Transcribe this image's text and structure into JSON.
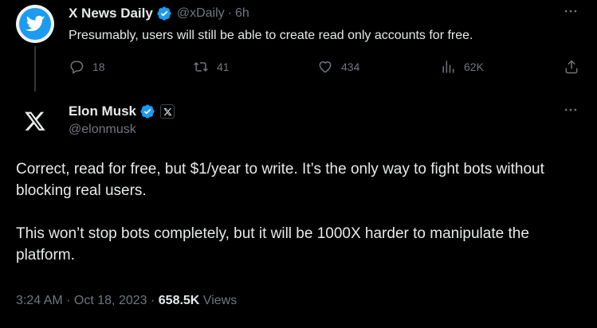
{
  "parent_tweet": {
    "author_name": "X News Daily",
    "handle": "@xDaily",
    "separator": "·",
    "time": "6h",
    "text": "Presumably, users will still be able to create read only accounts for free.",
    "actions": {
      "replies": "18",
      "reposts": "41",
      "likes": "434",
      "views": "62K"
    }
  },
  "main_tweet": {
    "author_name": "Elon Musk",
    "handle": "@elonmusk",
    "paragraphs": [
      "Correct, read for free, but $1/year to write. It’s the only way to fight bots without blocking real users.",
      "This won’t stop bots completely, but it will be 1000X harder to manipulate the platform."
    ],
    "timestamp": "3:24 AM · Oct 18, 2023 · ",
    "views_count": "658.5K",
    "views_label": " Views"
  },
  "colors": {
    "background": "#000000",
    "text": "#e7e9ea",
    "muted": "#71767b",
    "verified_blue": "#1d9bf0"
  },
  "icons": {
    "parent_avatar": "twitter-bird-icon",
    "main_avatar": "x-logo-icon",
    "more": "more-horizontal-icon",
    "reply": "reply-icon",
    "repost": "repost-icon",
    "like": "heart-icon",
    "views": "analytics-icon",
    "share": "share-icon"
  }
}
